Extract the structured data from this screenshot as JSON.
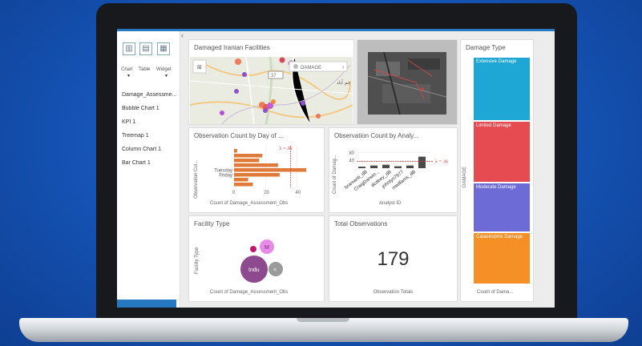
{
  "sidebar": {
    "tools": [
      {
        "label": "Chart",
        "icon": "bar-chart-icon"
      },
      {
        "label": "Table",
        "icon": "table-icon"
      },
      {
        "label": "Widget",
        "icon": "widget-icon"
      }
    ],
    "items": [
      "Damage_Assessme...",
      "Bubble Chart 1",
      "KPI 1",
      "Treemap 1",
      "Column Chart 1",
      "Bar Chart 1"
    ]
  },
  "map": {
    "title": "Damaged Iranian Facilities",
    "legend_label": "DAMAGE",
    "place_label": "جم آباد",
    "road_label": "37"
  },
  "day_chart": {
    "title": "Observation Count by Day of ...",
    "ylabel": "Observation Col...",
    "xlabel": "Count of Damage_Assessment_Obs",
    "annotation": "̅x = 36",
    "chart_data": {
      "type": "bar",
      "orientation": "horizontal",
      "categories": [
        "",
        "",
        "",
        "",
        "Tuesday",
        "Friday",
        "",
        ""
      ],
      "values": [
        2,
        18,
        16,
        28,
        46,
        29,
        9,
        12
      ],
      "xlim": [
        0,
        50
      ],
      "ticks": [
        "0",
        "20",
        "40"
      ],
      "mean": 36
    }
  },
  "analyst_chart": {
    "title": "Observation Count by Analy...",
    "ylabel": "Count of Damag...",
    "xlabel": "Analyst ID",
    "annotation": "̅x = 36",
    "chart_data": {
      "type": "bar",
      "categories": [
        "bramanti_dB",
        "CraigDarwin...",
        "dcdeey_dB",
        "johnlyn7977",
        "mwillams_dB",
        ""
      ],
      "values": [
        8,
        14,
        18,
        10,
        14,
        60
      ],
      "ylim": [
        0,
        100
      ],
      "ticks": [
        "80",
        "40"
      ],
      "mean": 36
    }
  },
  "facility": {
    "title": "Facility Type",
    "ylabel": "Facility Type",
    "xlabel": "Count of Damage_Assessment_Obs",
    "bubbles": [
      {
        "label": "Indu",
        "color": "#8e4a8e"
      },
      {
        "label": "M",
        "color": "#e78ae8"
      },
      {
        "label": "<",
        "color": "#9a9a9a"
      },
      {
        "label": "",
        "color": "#c2186b"
      }
    ]
  },
  "kpi": {
    "title": "Total Observations",
    "value": "179",
    "caption": "Observation Totals"
  },
  "treemap": {
    "title": "Damage Type",
    "ylabel": "DAMAGE",
    "footer": "Count of Dama...",
    "cells": [
      {
        "label": "Extensive Damage",
        "color": "#1ea7d4",
        "share": 0.28
      },
      {
        "label": "Limited Damage",
        "color": "#e54b50",
        "share": 0.27
      },
      {
        "label": "Moderate Damage",
        "color": "#6d6bd6",
        "share": 0.22
      },
      {
        "label": "Catastrophic Damage",
        "color": "#f49026",
        "share": 0.23
      }
    ]
  }
}
